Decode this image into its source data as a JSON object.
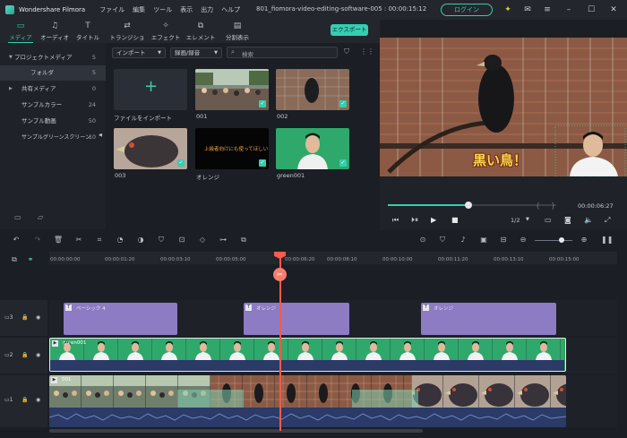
{
  "app": {
    "name": "Wondershare Filmora",
    "window_title": "801_fiomora-video-editing-software-005 : 00:00:15:12",
    "menu": [
      "ファイル",
      "編集",
      "ツール",
      "表示",
      "出力",
      "ヘルプ"
    ],
    "login_label": "ログイン"
  },
  "toolbar": {
    "tabs": [
      {
        "label": "メディア",
        "icon": "folder-icon"
      },
      {
        "label": "オーディオ",
        "icon": "music-note-icon"
      },
      {
        "label": "タイトル",
        "icon": "text-icon"
      },
      {
        "label": "トランジション",
        "icon": "transition-icon"
      },
      {
        "label": "エフェクト",
        "icon": "effects-icon"
      },
      {
        "label": "エレメント",
        "icon": "elements-icon"
      },
      {
        "label": "分割表示",
        "icon": "split-screen-icon"
      }
    ],
    "export_label": "エクスポート"
  },
  "sidebar": {
    "items": [
      {
        "label": "プロジェクトメディア",
        "count": "5"
      },
      {
        "label": "フォルダ",
        "count": "5"
      },
      {
        "label": "共有メディア",
        "count": "0"
      },
      {
        "label": "サンプルカラー",
        "count": "24"
      },
      {
        "label": "サンプル動画",
        "count": "50"
      },
      {
        "label": "サンプルグリーンスクリーン",
        "count": "10"
      }
    ]
  },
  "media": {
    "import_dropdown": "インポート",
    "record_dropdown": "録画/録音",
    "search_placeholder": "検索",
    "import_tile_label": "ファイルをインポート",
    "items": [
      {
        "label": "001"
      },
      {
        "label": "002"
      },
      {
        "label": "003"
      },
      {
        "label": "オレンジ",
        "caption": "上級者向けにも使ってほしい"
      },
      {
        "label": "green001"
      }
    ]
  },
  "preview": {
    "subtitle": "黒い鳥！",
    "timecode": "00:00:06:27",
    "zoom": "1/2",
    "progress": 0.48
  },
  "timeline": {
    "ruler": [
      "00:00:00:00",
      "00:00:01:20",
      "00:00:03:10",
      "00:00:05:00",
      "00:00:06:20",
      "00:00:08:10",
      "00:00:10:00",
      "00:00:11:20",
      "00:00:13:10",
      "00:00:15:00"
    ],
    "tracks": [
      {
        "number": "3"
      },
      {
        "number": "2"
      },
      {
        "number": "1"
      }
    ],
    "title_clips": [
      "ベーシック 4",
      "オレンジ",
      "オレンジ"
    ],
    "video_clip_label": "green001",
    "main_clip_label": "001"
  },
  "colors": {
    "accent": "#36cdb1",
    "playhead": "#ff5a4d",
    "title_clip": "#8d7bc4",
    "video_clip": "#2f9e5c",
    "main_clip": "#4a5a8a"
  }
}
